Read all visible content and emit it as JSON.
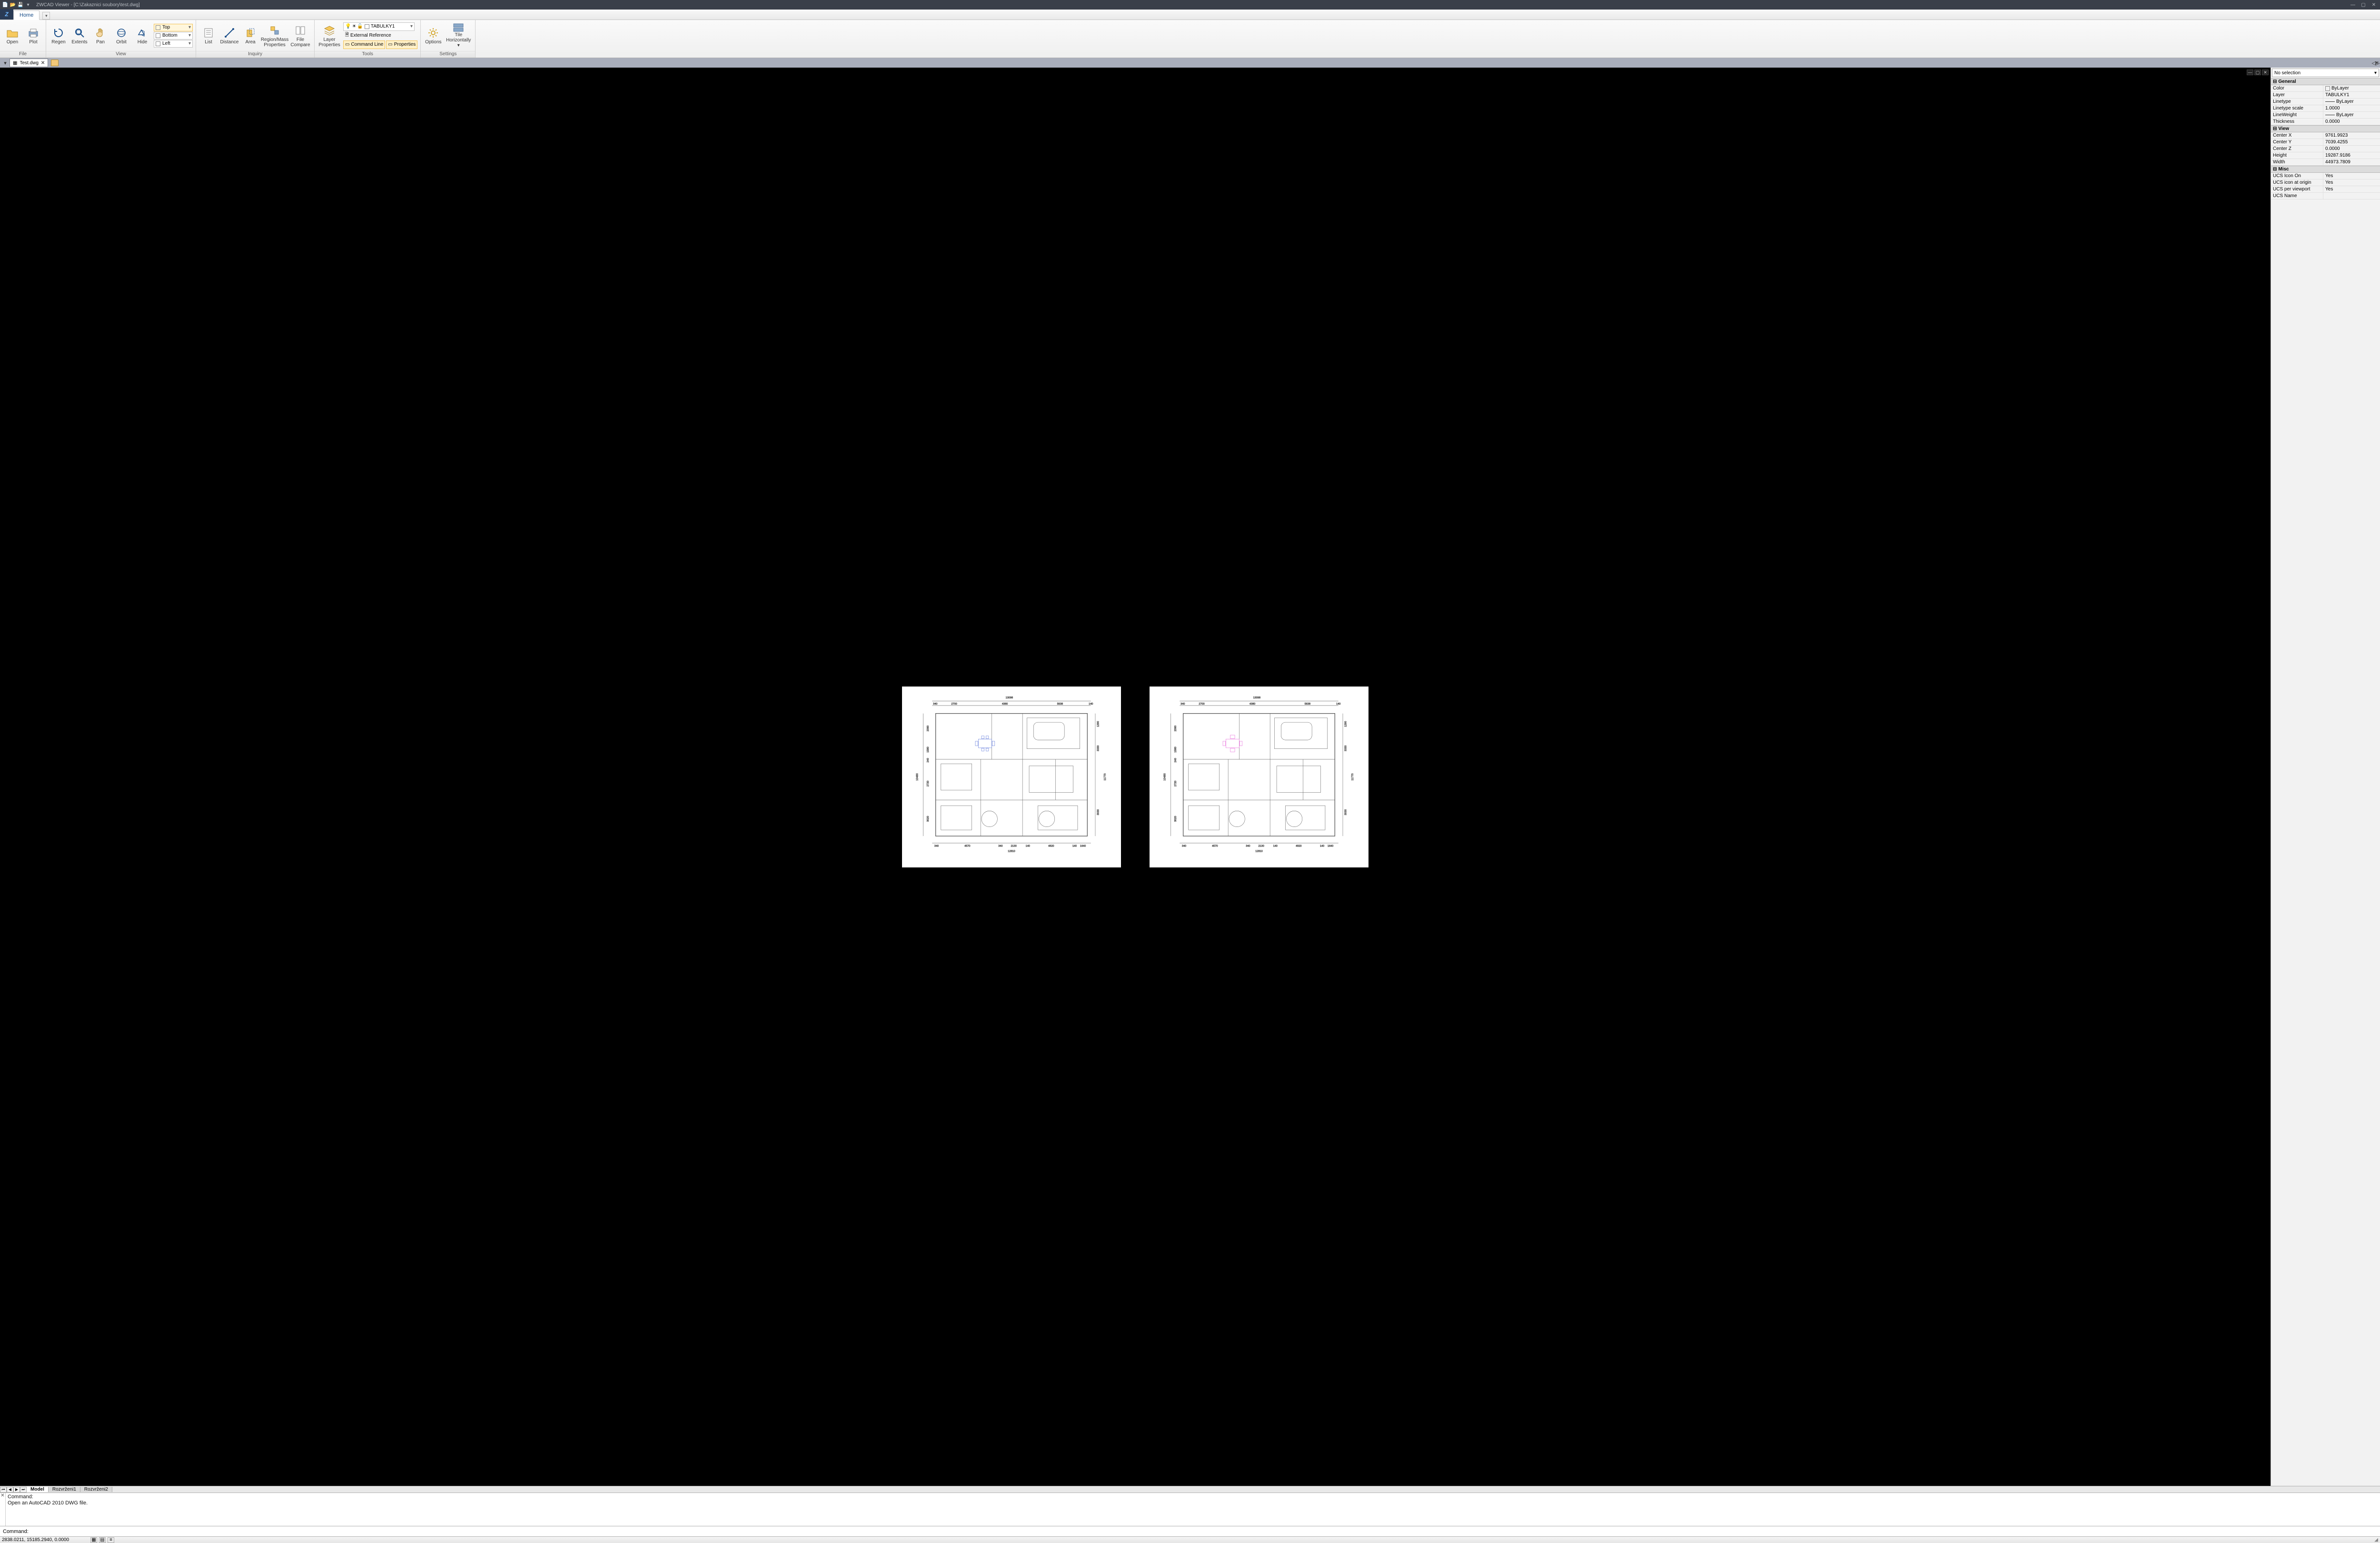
{
  "title_bar": {
    "app_title": "ZWCAD Viewer - [C:\\Zakaznici soubory\\test.dwg]",
    "qat_icons": [
      "new-icon",
      "open-icon",
      "save-icon",
      "qat-dropdown-icon"
    ]
  },
  "ribbon_tab": {
    "home": "Home"
  },
  "ribbon": {
    "file": {
      "label": "File",
      "open": "Open",
      "plot": "Plot"
    },
    "view": {
      "label": "View",
      "regen": "Regen",
      "extents": "Extents",
      "pan": "Pan",
      "orbit": "Orbit",
      "hide": "Hide",
      "top": "Top",
      "bottom": "Bottom",
      "left": "Left"
    },
    "inquiry": {
      "label": "Inquiry",
      "list": "List",
      "distance": "Distance",
      "area": "Area",
      "region_mass": "Region/Mass",
      "region_mass2": "Properties",
      "file_compare": "File",
      "file_compare2": "Compare"
    },
    "tools": {
      "label": "Tools",
      "layer_props": "Layer",
      "layer_props2": "Properties",
      "combo_value": "TABULKY1",
      "xref": "External Reference",
      "cmdline": "Command Line",
      "props": "Properties"
    },
    "settings": {
      "label": "Settings",
      "options": "Options",
      "tile": "Tile",
      "tile2": "Horizontally"
    }
  },
  "doc_tabs": {
    "tab1": "Test.dwg"
  },
  "props_panel": {
    "selection": "No selection",
    "groups": {
      "general": "General",
      "view": "View",
      "misc": "Misc"
    },
    "rows": {
      "color_k": "Color",
      "color_v": "ByLayer",
      "layer_k": "Layer",
      "layer_v": "TABULKY1",
      "linetype_k": "Linetype",
      "linetype_v": "ByLayer",
      "ltscale_k": "Linetype scale",
      "ltscale_v": "1.0000",
      "lweight_k": "LineWeight",
      "lweight_v": "ByLayer",
      "thickness_k": "Thickness",
      "thickness_v": "0.0000",
      "cx_k": "Center X",
      "cx_v": "9761.9923",
      "cy_k": "Center Y",
      "cy_v": "7039.4255",
      "cz_k": "Center Z",
      "cz_v": "0.0000",
      "h_k": "Height",
      "h_v": "19287.9186",
      "w_k": "Width",
      "w_v": "44973.7809",
      "ucs_on_k": "UCS Icon On",
      "ucs_on_v": "Yes",
      "ucs_org_k": "UCS icon at origin",
      "ucs_org_v": "Yes",
      "ucs_vp_k": "UCS per viewport",
      "ucs_vp_v": "Yes",
      "ucs_name_k": "UCS Name",
      "ucs_name_v": ""
    }
  },
  "layout_tabs": {
    "model": "Model",
    "l1": "Rozvrženi1",
    "l2": "Rozvrženi2"
  },
  "command": {
    "hist1": "Command:",
    "hist2": "Open an AutoCAD 2010 DWG file.",
    "prompt": "Command:"
  },
  "status": {
    "coords": "2838.0211, 15185.2940, 0.0000"
  },
  "floorplan": {
    "dims_top": {
      "total": "13098",
      "a": "2700",
      "b": "4380",
      "c": "5638",
      "m1": "340",
      "m2": "140"
    },
    "dims_left": {
      "total": "10480",
      "a": "2090",
      "b": "1580",
      "m": "240",
      "c": "2720",
      "d": "3020"
    },
    "dims_right": {
      "a": "1290",
      "b": "3330",
      "c": "11770",
      "d": "3030"
    },
    "dims_bot": {
      "a": "4570",
      "b": "2130",
      "c": "4820",
      "d": "1640",
      "m": "340",
      "m2": "140",
      "total": "12810"
    }
  }
}
